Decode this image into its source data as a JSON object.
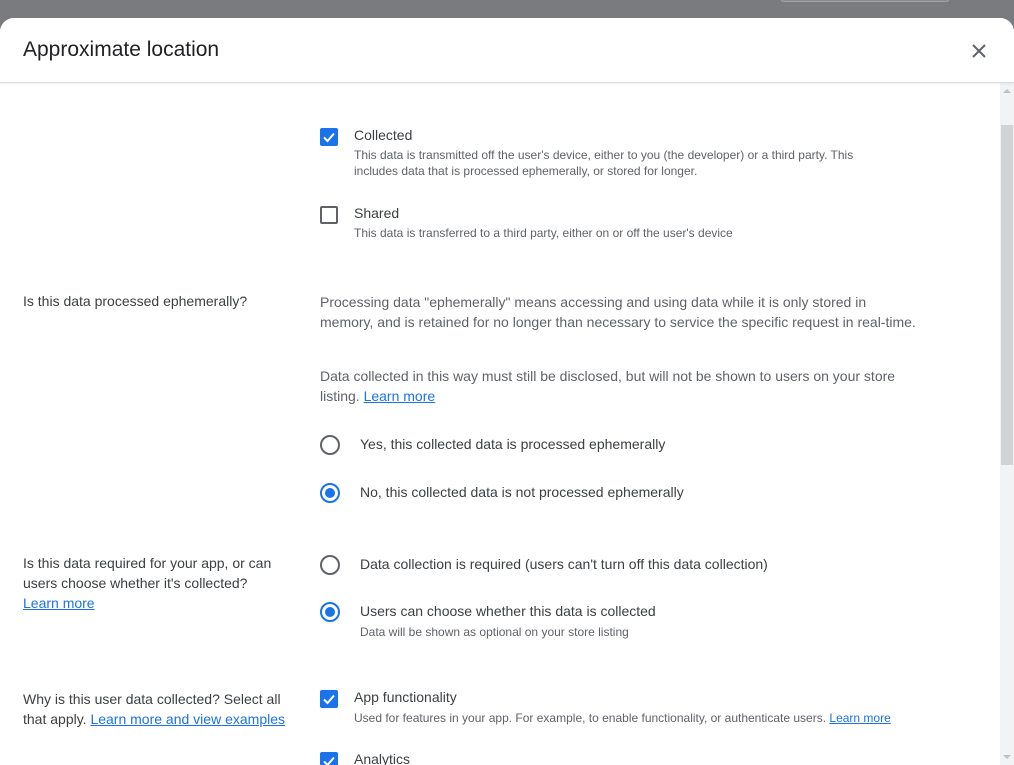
{
  "dialog": {
    "title": "Approximate location"
  },
  "data_type": {
    "collected": {
      "label": "Collected",
      "checked": true,
      "description": "This data is transmitted off the user's device, either to you (the developer) or a third party. This includes data that is processed ephemerally, or stored for longer."
    },
    "shared": {
      "label": "Shared",
      "checked": false,
      "description": "This data is transferred to a third party, either on or off the user's device"
    }
  },
  "ephemeral": {
    "question": "Is this data processed ephemerally?",
    "explanation": "Processing data \"ephemerally\" means accessing and using data while it is only stored in memory, and is retained for no longer than necessary to service the specific request in real-time.",
    "disclosure": "Data collected in this way must still be disclosed, but will not be shown to users on your store listing.",
    "learn_more": "Learn more",
    "options": [
      {
        "label": "Yes, this collected data is processed ephemerally",
        "selected": false
      },
      {
        "label": "No, this collected data is not processed ephemerally",
        "selected": true
      }
    ]
  },
  "required": {
    "question": "Is this data required for your app, or can users choose whether it's collected?",
    "learn_more": "Learn more",
    "options": [
      {
        "label": "Data collection is required (users can't turn off this data collection)",
        "selected": false
      },
      {
        "label": "Users can choose whether this data is collected",
        "selected": true,
        "description": "Data will be shown as optional on your store listing"
      }
    ]
  },
  "purpose": {
    "question": "Why is this user data collected? Select all that apply.",
    "learn_more": "Learn more and view examples",
    "options": [
      {
        "label": "App functionality",
        "checked": true,
        "description": "Used for features in your app. For example, to enable functionality, or authenticate users.",
        "learn_more": "Learn more"
      },
      {
        "label": "Analytics",
        "checked": true
      }
    ]
  },
  "colors": {
    "accent": "#1a73e8",
    "text": "#3c4043",
    "secondary_text": "#5f6368",
    "backdrop": "#7a7b7e"
  }
}
